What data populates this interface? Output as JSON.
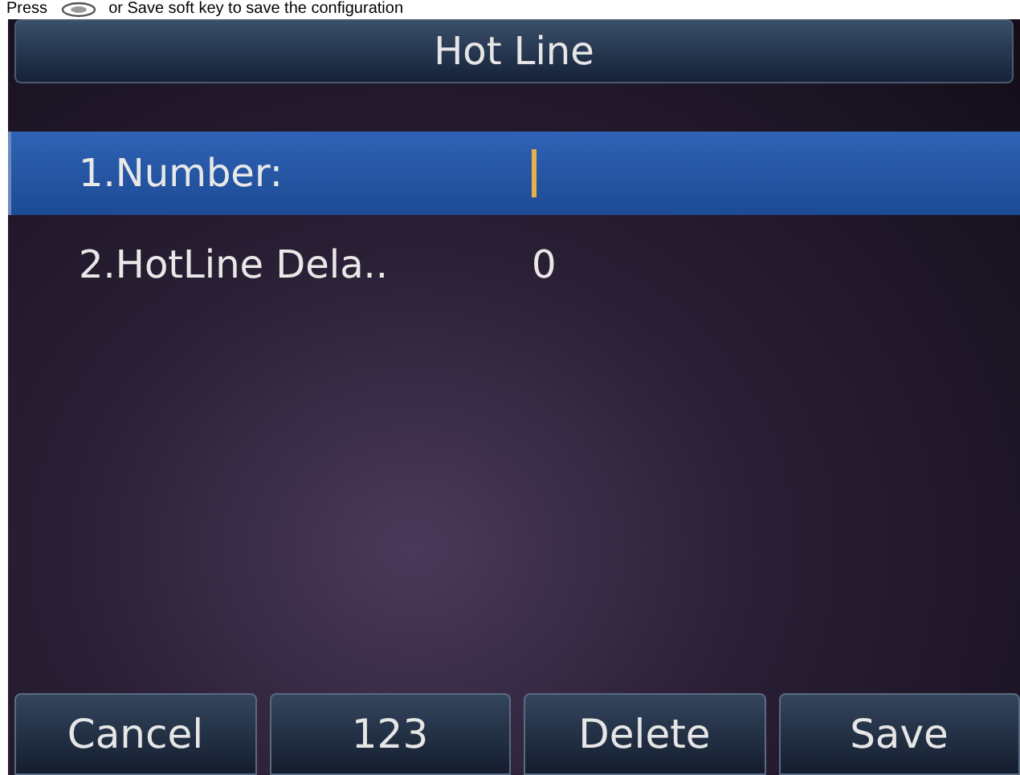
{
  "instruction": {
    "before_icon": "Press",
    "after_icon": "or Save soft key to save the configuration"
  },
  "title": "Hot Line",
  "items": [
    {
      "label": "1.Number:",
      "kind": "input",
      "selected": true
    },
    {
      "label": "2.HotLine Dela..",
      "kind": "value",
      "value": "0",
      "selected": false
    }
  ],
  "softkeys": [
    "Cancel",
    "123",
    "Delete",
    "Save"
  ]
}
